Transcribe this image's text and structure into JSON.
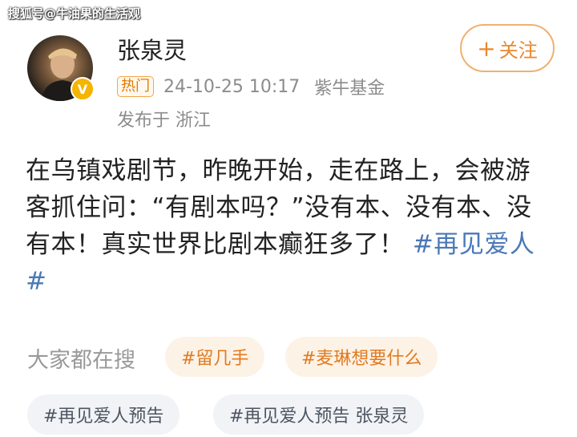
{
  "watermark": "搜狐号@牛油果的生活观",
  "post": {
    "username": "张泉灵",
    "hot_label": "热门",
    "timestamp": "24-10-25 10:17",
    "source": "紫牛基金",
    "location": "发布于 浙江",
    "follow_label": "关注",
    "text": "在乌镇戏剧节，昨晚开始，走在路上，会被游客抓住问：“有剧本吗？”没有本、没有本、没有本！真实世界比剧本癫狂多了！",
    "hashtag": "#再见爱人#"
  },
  "search": {
    "label": "大家都在搜",
    "chips": [
      "#留几手",
      "#麦琳想要什么",
      "#再见爱人预告",
      "#再见爱人预告 张泉灵"
    ]
  }
}
